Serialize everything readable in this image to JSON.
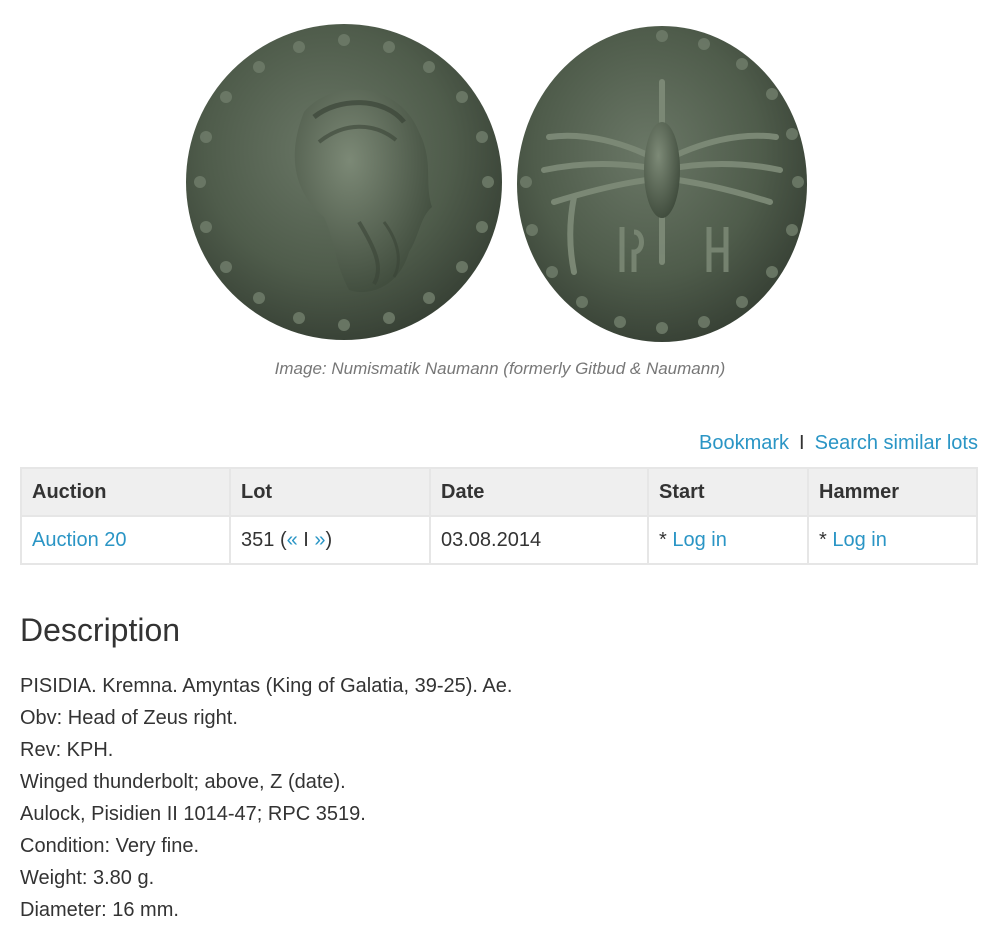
{
  "coin_images": {
    "obverse_alt": "Obverse: head of Zeus right",
    "reverse_alt": "Reverse: winged thunderbolt",
    "coin_color": "#4f5c4b"
  },
  "caption": "Image: Numismatik Naumann (formerly Gitbud & Naumann)",
  "actions": {
    "bookmark": "Bookmark",
    "separator": "I",
    "search_similar": "Search similar lots"
  },
  "table": {
    "headers": {
      "auction": "Auction",
      "lot": "Lot",
      "date": "Date",
      "start": "Start",
      "hammer": "Hammer"
    },
    "row": {
      "auction": "Auction 20",
      "lot_number": "351",
      "lot_open_paren": "(",
      "lot_prev": "«",
      "lot_sep": "I",
      "lot_next": "»",
      "lot_close_paren": ")",
      "date": "03.08.2014",
      "start_prefix": "*",
      "start_link": "Log in",
      "hammer_prefix": "*",
      "hammer_link": "Log in"
    }
  },
  "description": {
    "title": "Description",
    "lines": {
      "l1": "PISIDIA. Kremna. Amyntas (King of Galatia, 39-25). Ae.",
      "l2": "Obv: Head of Zeus right.",
      "l3": "Rev: KPH.",
      "l4": "Winged thunderbolt; above, Z (date).",
      "l5": "Aulock, Pisidien II 1014-47; RPC 3519.",
      "l6": "Condition: Very fine.",
      "l7": "Weight: 3.80 g.",
      "l8": "Diameter: 16 mm."
    }
  },
  "colors": {
    "link": "#2a95c5",
    "header_bg": "#efefef",
    "border": "#e6e6e6",
    "text": "#333333",
    "caption": "#777777"
  }
}
